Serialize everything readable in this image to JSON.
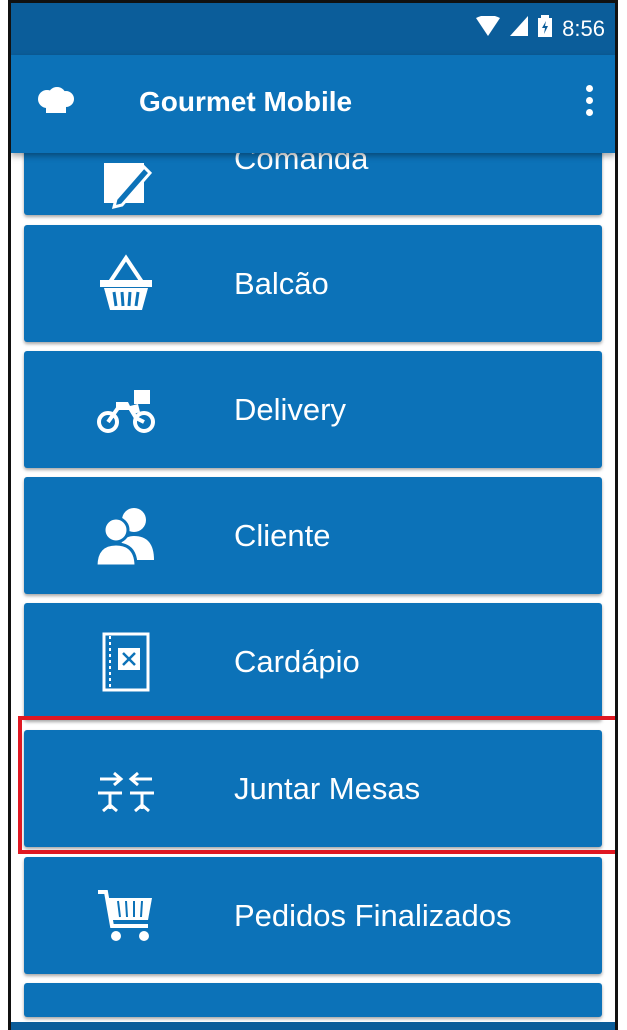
{
  "status_bar": {
    "time": "8:56"
  },
  "app_bar": {
    "title": "Gourmet Mobile"
  },
  "menu_items": [
    {
      "label": "Comanda",
      "icon": "pencil-note-icon"
    },
    {
      "label": "Balcão",
      "icon": "basket-icon"
    },
    {
      "label": "Delivery",
      "icon": "motorcycle-icon"
    },
    {
      "label": "Cliente",
      "icon": "users-icon"
    },
    {
      "label": "Cardápio",
      "icon": "menu-book-icon"
    },
    {
      "label": "Juntar Mesas",
      "icon": "join-tables-icon",
      "highlighted": true
    },
    {
      "label": "Pedidos Finalizados",
      "icon": "shopping-cart-icon"
    }
  ],
  "colors": {
    "primary": "#0c72b8",
    "status_bar": "#0b5d9a",
    "highlight": "#e01822"
  }
}
